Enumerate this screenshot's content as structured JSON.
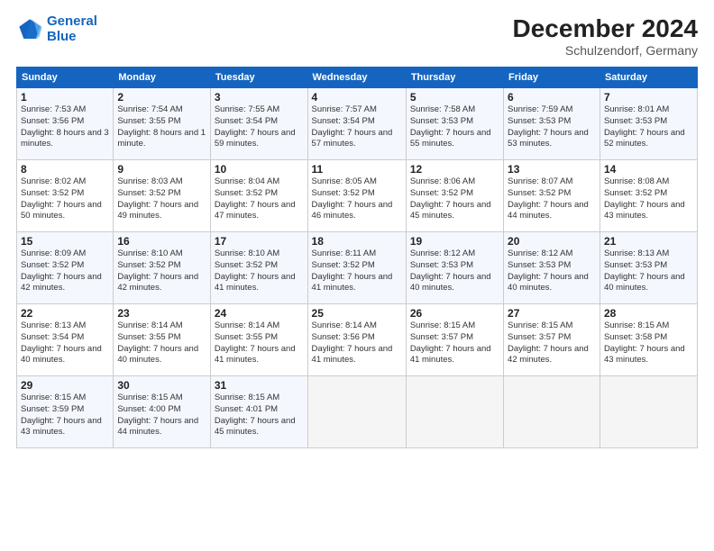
{
  "logo": {
    "line1": "General",
    "line2": "Blue"
  },
  "title": "December 2024",
  "subtitle": "Schulzendorf, Germany",
  "days_header": [
    "Sunday",
    "Monday",
    "Tuesday",
    "Wednesday",
    "Thursday",
    "Friday",
    "Saturday"
  ],
  "weeks": [
    [
      {
        "num": "1",
        "sunrise": "Sunrise: 7:53 AM",
        "sunset": "Sunset: 3:56 PM",
        "daylight": "Daylight: 8 hours and 3 minutes."
      },
      {
        "num": "2",
        "sunrise": "Sunrise: 7:54 AM",
        "sunset": "Sunset: 3:55 PM",
        "daylight": "Daylight: 8 hours and 1 minute."
      },
      {
        "num": "3",
        "sunrise": "Sunrise: 7:55 AM",
        "sunset": "Sunset: 3:54 PM",
        "daylight": "Daylight: 7 hours and 59 minutes."
      },
      {
        "num": "4",
        "sunrise": "Sunrise: 7:57 AM",
        "sunset": "Sunset: 3:54 PM",
        "daylight": "Daylight: 7 hours and 57 minutes."
      },
      {
        "num": "5",
        "sunrise": "Sunrise: 7:58 AM",
        "sunset": "Sunset: 3:53 PM",
        "daylight": "Daylight: 7 hours and 55 minutes."
      },
      {
        "num": "6",
        "sunrise": "Sunrise: 7:59 AM",
        "sunset": "Sunset: 3:53 PM",
        "daylight": "Daylight: 7 hours and 53 minutes."
      },
      {
        "num": "7",
        "sunrise": "Sunrise: 8:01 AM",
        "sunset": "Sunset: 3:53 PM",
        "daylight": "Daylight: 7 hours and 52 minutes."
      }
    ],
    [
      {
        "num": "8",
        "sunrise": "Sunrise: 8:02 AM",
        "sunset": "Sunset: 3:52 PM",
        "daylight": "Daylight: 7 hours and 50 minutes."
      },
      {
        "num": "9",
        "sunrise": "Sunrise: 8:03 AM",
        "sunset": "Sunset: 3:52 PM",
        "daylight": "Daylight: 7 hours and 49 minutes."
      },
      {
        "num": "10",
        "sunrise": "Sunrise: 8:04 AM",
        "sunset": "Sunset: 3:52 PM",
        "daylight": "Daylight: 7 hours and 47 minutes."
      },
      {
        "num": "11",
        "sunrise": "Sunrise: 8:05 AM",
        "sunset": "Sunset: 3:52 PM",
        "daylight": "Daylight: 7 hours and 46 minutes."
      },
      {
        "num": "12",
        "sunrise": "Sunrise: 8:06 AM",
        "sunset": "Sunset: 3:52 PM",
        "daylight": "Daylight: 7 hours and 45 minutes."
      },
      {
        "num": "13",
        "sunrise": "Sunrise: 8:07 AM",
        "sunset": "Sunset: 3:52 PM",
        "daylight": "Daylight: 7 hours and 44 minutes."
      },
      {
        "num": "14",
        "sunrise": "Sunrise: 8:08 AM",
        "sunset": "Sunset: 3:52 PM",
        "daylight": "Daylight: 7 hours and 43 minutes."
      }
    ],
    [
      {
        "num": "15",
        "sunrise": "Sunrise: 8:09 AM",
        "sunset": "Sunset: 3:52 PM",
        "daylight": "Daylight: 7 hours and 42 minutes."
      },
      {
        "num": "16",
        "sunrise": "Sunrise: 8:10 AM",
        "sunset": "Sunset: 3:52 PM",
        "daylight": "Daylight: 7 hours and 42 minutes."
      },
      {
        "num": "17",
        "sunrise": "Sunrise: 8:10 AM",
        "sunset": "Sunset: 3:52 PM",
        "daylight": "Daylight: 7 hours and 41 minutes."
      },
      {
        "num": "18",
        "sunrise": "Sunrise: 8:11 AM",
        "sunset": "Sunset: 3:52 PM",
        "daylight": "Daylight: 7 hours and 41 minutes."
      },
      {
        "num": "19",
        "sunrise": "Sunrise: 8:12 AM",
        "sunset": "Sunset: 3:53 PM",
        "daylight": "Daylight: 7 hours and 40 minutes."
      },
      {
        "num": "20",
        "sunrise": "Sunrise: 8:12 AM",
        "sunset": "Sunset: 3:53 PM",
        "daylight": "Daylight: 7 hours and 40 minutes."
      },
      {
        "num": "21",
        "sunrise": "Sunrise: 8:13 AM",
        "sunset": "Sunset: 3:53 PM",
        "daylight": "Daylight: 7 hours and 40 minutes."
      }
    ],
    [
      {
        "num": "22",
        "sunrise": "Sunrise: 8:13 AM",
        "sunset": "Sunset: 3:54 PM",
        "daylight": "Daylight: 7 hours and 40 minutes."
      },
      {
        "num": "23",
        "sunrise": "Sunrise: 8:14 AM",
        "sunset": "Sunset: 3:55 PM",
        "daylight": "Daylight: 7 hours and 40 minutes."
      },
      {
        "num": "24",
        "sunrise": "Sunrise: 8:14 AM",
        "sunset": "Sunset: 3:55 PM",
        "daylight": "Daylight: 7 hours and 41 minutes."
      },
      {
        "num": "25",
        "sunrise": "Sunrise: 8:14 AM",
        "sunset": "Sunset: 3:56 PM",
        "daylight": "Daylight: 7 hours and 41 minutes."
      },
      {
        "num": "26",
        "sunrise": "Sunrise: 8:15 AM",
        "sunset": "Sunset: 3:57 PM",
        "daylight": "Daylight: 7 hours and 41 minutes."
      },
      {
        "num": "27",
        "sunrise": "Sunrise: 8:15 AM",
        "sunset": "Sunset: 3:57 PM",
        "daylight": "Daylight: 7 hours and 42 minutes."
      },
      {
        "num": "28",
        "sunrise": "Sunrise: 8:15 AM",
        "sunset": "Sunset: 3:58 PM",
        "daylight": "Daylight: 7 hours and 43 minutes."
      }
    ],
    [
      {
        "num": "29",
        "sunrise": "Sunrise: 8:15 AM",
        "sunset": "Sunset: 3:59 PM",
        "daylight": "Daylight: 7 hours and 43 minutes."
      },
      {
        "num": "30",
        "sunrise": "Sunrise: 8:15 AM",
        "sunset": "Sunset: 4:00 PM",
        "daylight": "Daylight: 7 hours and 44 minutes."
      },
      {
        "num": "31",
        "sunrise": "Sunrise: 8:15 AM",
        "sunset": "Sunset: 4:01 PM",
        "daylight": "Daylight: 7 hours and 45 minutes."
      },
      null,
      null,
      null,
      null
    ]
  ]
}
